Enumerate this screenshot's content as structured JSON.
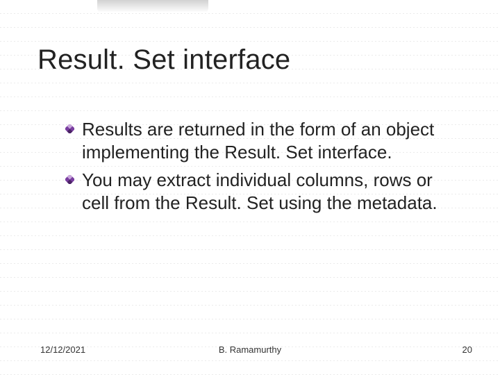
{
  "title": "Result. Set interface",
  "bullets": [
    "Results are returned in the form of an object implementing the Result. Set interface.",
    "You may extract individual columns, rows or cell from the Result. Set using the metadata."
  ],
  "footer": {
    "date": "12/12/2021",
    "author": "B. Ramamurthy",
    "page": "20"
  },
  "accent_color": "#7a3ea0"
}
